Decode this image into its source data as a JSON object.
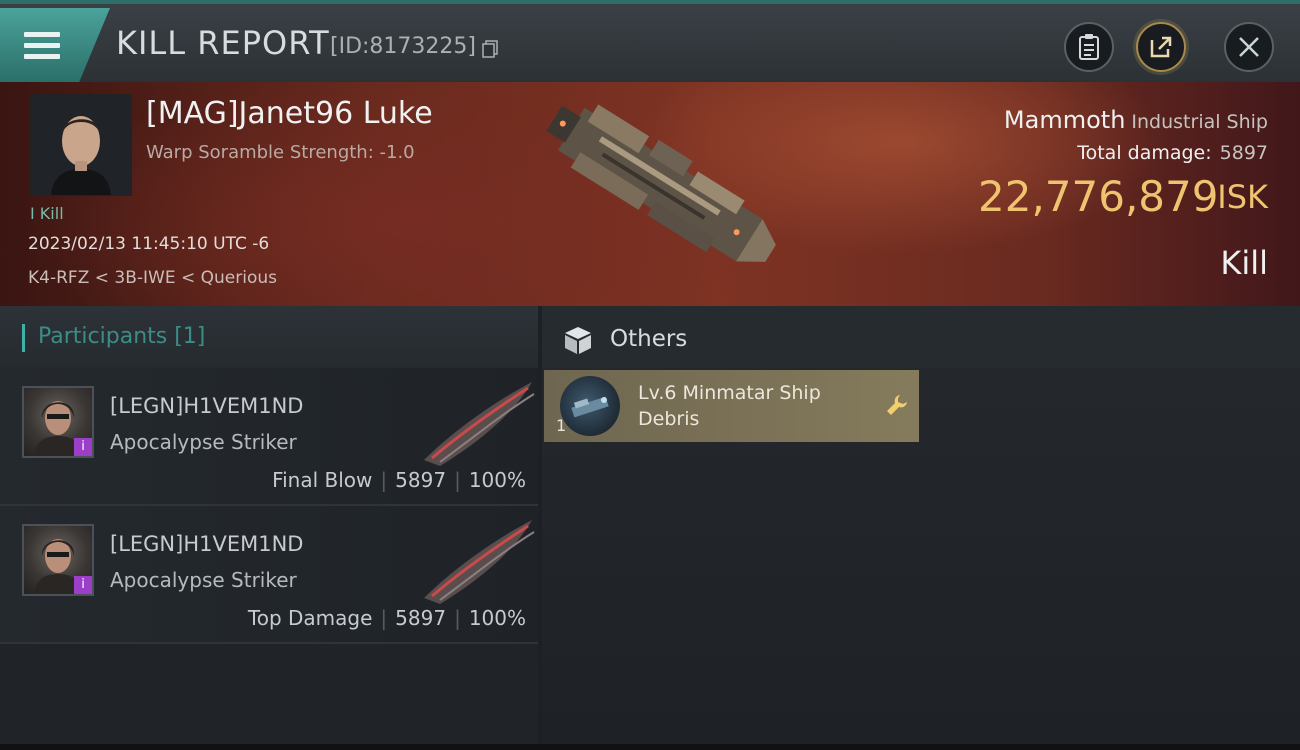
{
  "header": {
    "title": "KILL REPORT",
    "report_id": "[ID:8173225]"
  },
  "victim": {
    "name": "[MAG]Janet96 Luke",
    "warp_scramble": "Warp Soramble Strength: -1.0",
    "kill_tag": "I Kill",
    "datetime": "2023/02/13 11:45:10 UTC -6",
    "location": "K4-RFZ < 3B-IWE < Querious",
    "ship_name": "Mammoth",
    "ship_class": "Industrial Ship",
    "total_damage_label": "Total damage:",
    "total_damage": "5897",
    "isk_value": "22,776,879",
    "isk_unit": "ISK",
    "result": "Kill"
  },
  "participants": {
    "header": "Participants [1]",
    "rows": [
      {
        "name": "[LEGN]H1VEM1ND",
        "ship": "Apocalypse Striker",
        "role": "Final Blow",
        "damage": "5897",
        "percent": "100%",
        "badge": "i"
      },
      {
        "name": "[LEGN]H1VEM1ND",
        "ship": "Apocalypse Striker",
        "role": "Top Damage",
        "damage": "5897",
        "percent": "100%",
        "badge": "i"
      }
    ]
  },
  "others": {
    "header": "Others",
    "items": [
      {
        "name": "Lv.6 Minmatar Ship Debris",
        "qty": "1"
      }
    ]
  },
  "colors": {
    "accent_teal": "#3fb1a6",
    "isk_gold": "#efc36f",
    "item_card": "#857b5c",
    "badge_purple": "#9b3fc9"
  }
}
